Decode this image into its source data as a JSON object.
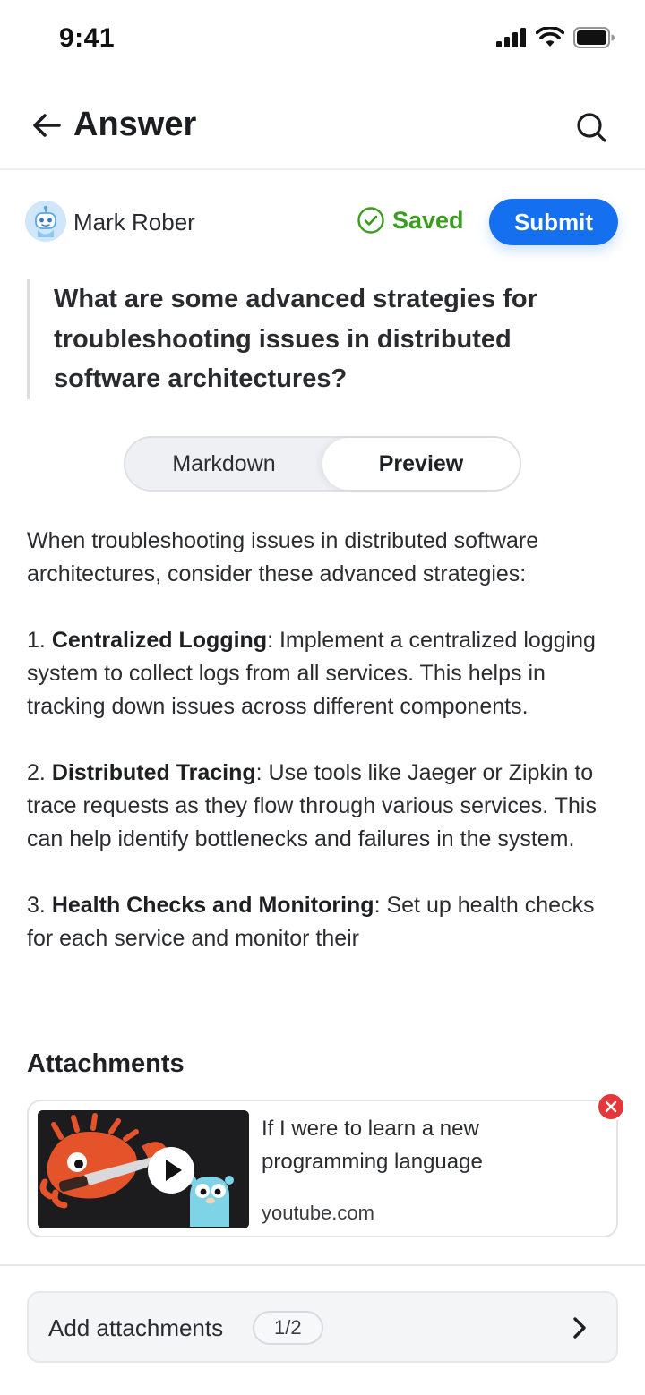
{
  "status_bar": {
    "time": "9:41"
  },
  "nav": {
    "title": "Answer"
  },
  "author": {
    "name": "Mark Rober"
  },
  "save_state": {
    "label": "Saved",
    "color": "#3a9d1f"
  },
  "submit": {
    "label": "Submit",
    "color": "#1570ef"
  },
  "question": {
    "text": "What are some advanced strategies for troubleshooting issues in distributed software architectures?"
  },
  "tabs": {
    "markdown": "Markdown",
    "preview": "Preview",
    "selected": "Preview"
  },
  "content": {
    "intro": "When troubleshooting issues in distributed software architectures, consider these advanced strategies:",
    "items": [
      {
        "num": "1.",
        "title": "Centralized Logging",
        "text": ": Implement a centralized logging system to collect logs from all services. This helps in tracking down issues across different components."
      },
      {
        "num": "2.",
        "title": "Distributed Tracing",
        "text": ": Use tools like Jaeger or Zipkin to trace requests as they flow through various services. This can help identify bottlenecks and failures in the system."
      },
      {
        "num": "3.",
        "title": "Health Checks and Monitoring",
        "text": ": Set up health checks for each service and monitor their"
      }
    ]
  },
  "attachments": {
    "heading": "Attachments",
    "items": [
      {
        "title": "If I were to learn a new programming language",
        "domain": "youtube.com"
      }
    ],
    "add_label": "Add attachments",
    "count": "1/2"
  }
}
